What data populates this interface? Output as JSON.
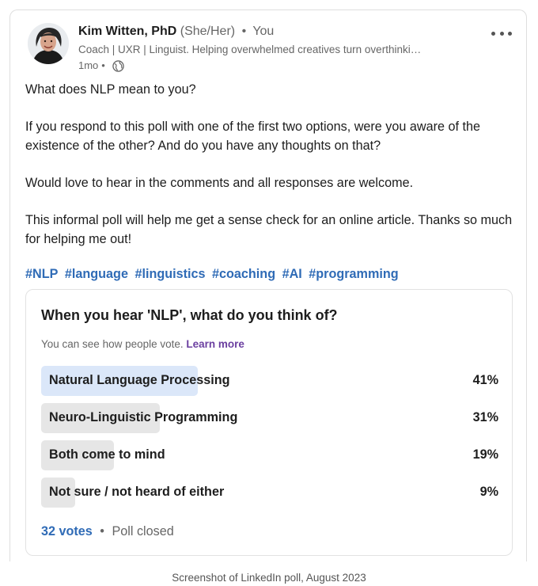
{
  "author": {
    "name": "Kim Witten, PhD",
    "pronouns": "(She/Her)",
    "separator": "•",
    "relation": "You",
    "headline": "Coach | UXR | Linguist. Helping overwhelmed creatives turn overthinki…",
    "time": "1mo",
    "visibility_icon": "globe-icon"
  },
  "post": {
    "paragraphs": [
      "What does NLP mean to you?",
      "If you respond to this poll with one of the first two options, were you aware of the existence of the other? And do you have any thoughts on that?",
      "Would love to hear in the comments and all responses are welcome.",
      "This informal poll will help me get a sense check for an online article. Thanks so much for helping me out!"
    ],
    "hashtags": [
      "#NLP",
      "#language",
      "#linguistics",
      "#coaching",
      "#AI",
      "#programming"
    ]
  },
  "poll": {
    "question": "When you hear 'NLP', what do you think of?",
    "note": "You can see how people vote.",
    "learn_more": "Learn more",
    "options": [
      {
        "label": "Natural Language Processing",
        "percent_text": "41%",
        "percent": 41
      },
      {
        "label": "Neuro-Linguistic Programming",
        "percent_text": "31%",
        "percent": 31
      },
      {
        "label": "Both come to mind",
        "percent_text": "19%",
        "percent": 19
      },
      {
        "label": "Not sure / not heard of either",
        "percent_text": "9%",
        "percent": 9
      }
    ],
    "votes": "32 votes",
    "status": "Poll closed"
  },
  "caption": "Screenshot of LinkedIn poll, August 2023",
  "colors": {
    "link": "#2f6bb6",
    "learn_more": "#6b3fa0",
    "winning_bar": "#dbe7f9",
    "bar": "#e6e6e6"
  }
}
